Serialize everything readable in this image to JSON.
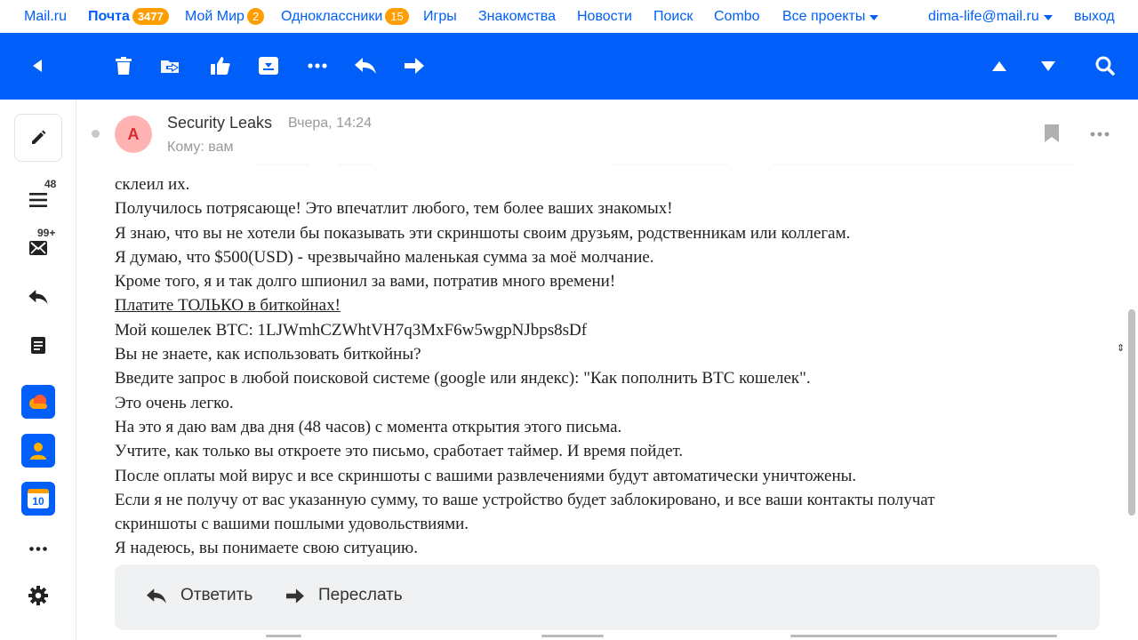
{
  "portal": {
    "mailru": "Mail.ru",
    "pochta": "Почта",
    "pochta_count": "3477",
    "moimir": "Мой Мир",
    "moimir_count": "2",
    "ok": "Одноклассники",
    "ok_count": "15",
    "games": "Игры",
    "dating": "Знакомства",
    "news": "Новости",
    "search": "Поиск",
    "combo": "Combo",
    "all_projects": "Все проекты",
    "user": "dima-life@mail.ru",
    "logout": "выход"
  },
  "toolbar": {
    "icons": [
      "back-icon",
      "trash-icon",
      "move-icon",
      "like-icon",
      "archive-icon",
      "more-icon",
      "reply-icon",
      "forward-icon",
      "prev-icon",
      "next-icon",
      "search-icon"
    ]
  },
  "sidebar": {
    "inbox_count": "48",
    "unread_count": "99+",
    "icons": [
      "compose-icon",
      "folders-icon",
      "unread-icon",
      "sent-icon",
      "drafts-icon",
      "cloud-app-icon",
      "contacts-app-icon",
      "calendar-app-icon",
      "more-apps-icon",
      "settings-icon"
    ],
    "calendar_day": "10"
  },
  "message": {
    "avatar_letter": "A",
    "sender": "Security Leaks",
    "date": "Вчера, 14:24",
    "to": "Кому: вам",
    "lines": [
      "склеил их.",
      "Получилось потрясающе! Это впечатлит любого, тем более ваших знакомых!",
      "Я знаю, что вы не хотели бы показывать эти скриншоты своим друзьям, родственникам или коллегам.",
      "Я думаю, что $500(USD) - чрезвычайно маленькая сумма за моё молчание.",
      "Кроме того, я и так долго шпионил за вами, потратив много времени!",
      "Платите ТОЛЬКО в биткойнах!",
      "Мой кошелек BTC: 1LJWmhCZWhtVH7q3MxF6w5wgpNJbps8sDf",
      "Вы не знаете, как использовать биткойны?",
      "Введите запрос в любой поисковой системе (google или яндекс): \"Как пополнить BTC кошелек\".",
      "Это очень легко.",
      "На это я даю вам два дня (48 часов) с момента открытия этого письма.",
      "Учтите, как только вы откроете это письмо, сработает таймер. И время пойдет.",
      "После оплаты мой вирус и все скриншоты с вашими развлечениями будут автоматически уничтожены.",
      "Если я не получу от вас указанную сумму, то ваше устройство будет заблокировано, и все ваши контакты получат",
      "скриншоты с вашими пошлыми удовольствиями.",
      "Я надеюсь, вы понимаете свою ситуацию."
    ]
  },
  "replybar": {
    "reply": "Ответить",
    "forward": "Переслать"
  }
}
